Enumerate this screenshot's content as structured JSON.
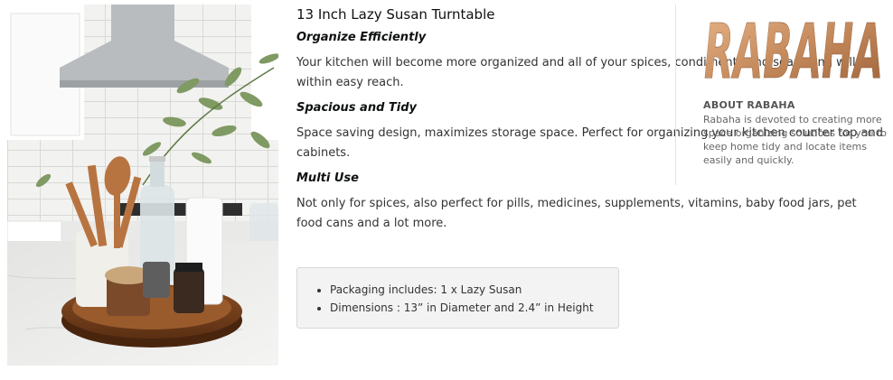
{
  "product_image": {
    "alt": "Wooden lazy susan turntable on a kitchen counter with utensils, spice jars, paper towel and a glass bottle"
  },
  "description": {
    "title": "13 Inch Lazy Susan Turntable",
    "sections": [
      {
        "heading": "Organize Efficiently",
        "text": "Your kitchen will become more organized and all of your spices, condiments and seasoning will be within easy reach."
      },
      {
        "heading": "Spacious and Tidy",
        "text": "Space saving design, maximizes storage space. Perfect for organizing your kitchen counter top and cabinets."
      },
      {
        "heading": "Multi Use",
        "text": "Not only for spices, also perfect for pills, medicines, supplements, vitamins, baby food jars, pet food cans and a lot more."
      }
    ],
    "features": [
      "Packaging includes: 1 x Lazy Susan",
      "Dimensions : 13” in Diameter and 2.4” in Height"
    ]
  },
  "brand": {
    "logo_text": "RABAHA",
    "logo_color": "#c58a5c",
    "about_heading": "ABOUT RABAHA",
    "about_text": "Rabaha is devoted to creating more space organizing solutions for you to keep home tidy and locate items easily and quickly."
  }
}
